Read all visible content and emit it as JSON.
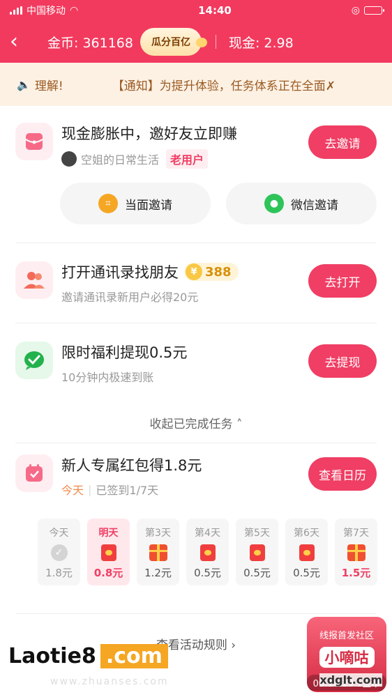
{
  "status_bar": {
    "carrier": "中国移动",
    "time": "14:40"
  },
  "header": {
    "coins_label": "金币: 361168",
    "pill_label": "瓜分百亿",
    "cash_label": "现金: 2.98",
    "colors": {
      "brand": "#f23a5e"
    }
  },
  "notice": {
    "text_a": "理解!",
    "text_b": "【通知】为提升体验，任务体系正在全面✗"
  },
  "tasks": [
    {
      "title": "现金膨胀中，邀好友立即赚",
      "user_name": "空姐的日常生活",
      "user_badge": "老用户",
      "button": "去邀请",
      "icon": "red-envelope-icon"
    },
    {
      "title": "打开通讯录找朋友",
      "reward": "388",
      "subtitle": "邀请通讯录新用户必得20元",
      "button": "去打开",
      "icon": "contacts-icon"
    },
    {
      "title": "限时福利提现0.5元",
      "subtitle": "10分钟内极速到账",
      "button": "去提现",
      "icon": "wechat-check-icon"
    }
  ],
  "invite_buttons": {
    "face": "当面邀请",
    "wechat": "微信邀请"
  },
  "collapse_label": "收起已完成任务",
  "checkin": {
    "title": "新人专属红包得1.8元",
    "today": "今天",
    "progress": "已签到1/7天",
    "button": "查看日历",
    "days": [
      {
        "label": "今天",
        "value": "1.8元",
        "state": "done",
        "icon": "check-icon"
      },
      {
        "label": "明天",
        "value": "0.8元",
        "state": "active",
        "icon": "red-envelope-icon"
      },
      {
        "label": "第3天",
        "value": "1.2元",
        "state": "normal",
        "icon": "gift-icon"
      },
      {
        "label": "第4天",
        "value": "0.5元",
        "state": "normal",
        "icon": "red-envelope-icon"
      },
      {
        "label": "第5天",
        "value": "0.5元",
        "state": "normal",
        "icon": "red-envelope-icon"
      },
      {
        "label": "第6天",
        "value": "0.5元",
        "state": "normal",
        "icon": "red-envelope-icon"
      },
      {
        "label": "第7天",
        "value": "1.5元",
        "state": "last",
        "icon": "gift-icon"
      }
    ]
  },
  "rules_label": "查看活动规则",
  "float_widget": {
    "line1": "线报首发社区",
    "line2": "小嘀咕",
    "timer": "00:14:29 1金币"
  },
  "watermark": {
    "brand_a": "Laotie8",
    "brand_b": ".com",
    "sub": "www.zhuanses.com",
    "right": "xdglt.com"
  }
}
